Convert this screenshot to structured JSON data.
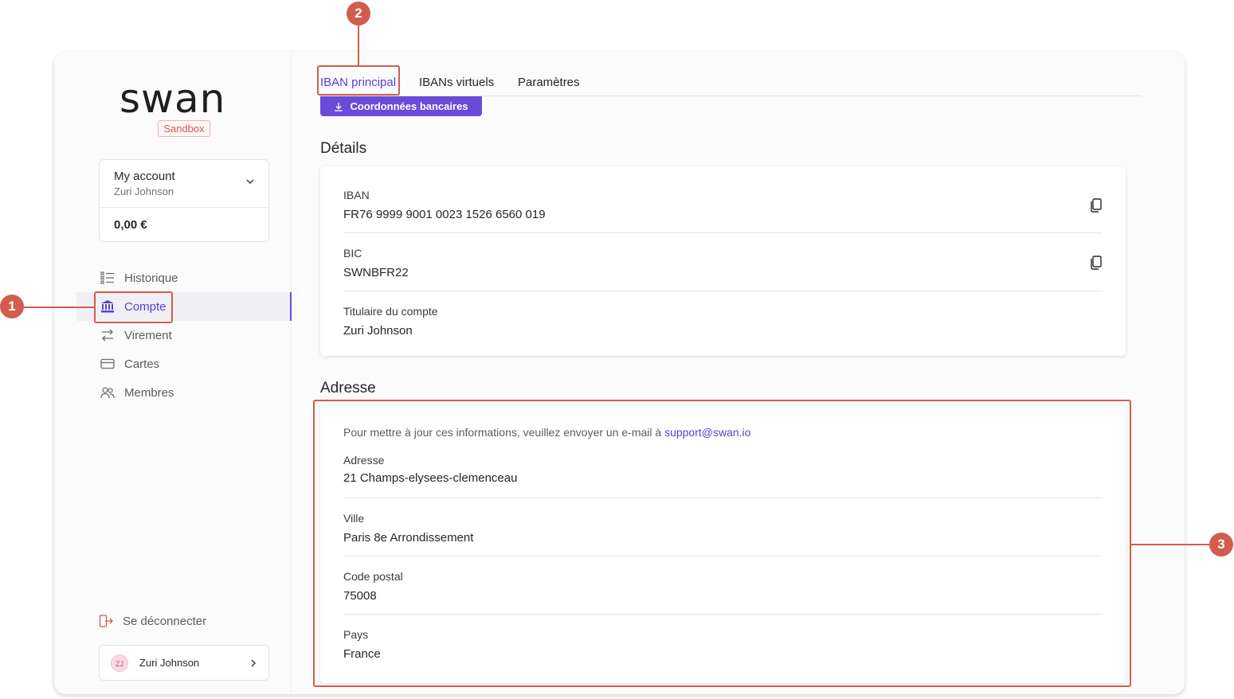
{
  "brand": {
    "logo": "swan",
    "env_badge": "Sandbox"
  },
  "account": {
    "name": "My account",
    "holder": "Zuri Johnson",
    "balance": "0,00 €"
  },
  "nav": {
    "items": [
      {
        "label": "Historique",
        "icon": "list-icon"
      },
      {
        "label": "Compte",
        "icon": "bank-icon"
      },
      {
        "label": "Virement",
        "icon": "transfer-icon"
      },
      {
        "label": "Cartes",
        "icon": "card-icon"
      },
      {
        "label": "Membres",
        "icon": "members-icon"
      }
    ],
    "active": "Compte",
    "logout_label": "Se déconnecter"
  },
  "user": {
    "initials": "ZJ",
    "name": "Zuri Johnson"
  },
  "tabs": [
    {
      "label": "IBAN principal"
    },
    {
      "label": "IBANs virtuels"
    },
    {
      "label": "Paramètres"
    }
  ],
  "active_tab": "IBAN principal",
  "download_button": "Coordonnées bancaires",
  "details": {
    "title": "Détails",
    "fields": [
      {
        "label": "IBAN",
        "value": "FR76 9999 9001 0023 1526 6560 019",
        "copyable": true
      },
      {
        "label": "BIC",
        "value": "SWNBFR22",
        "copyable": true
      },
      {
        "label": "Titulaire du compte",
        "value": "Zuri Johnson",
        "copyable": false
      }
    ]
  },
  "address": {
    "title": "Adresse",
    "note": "Pour mettre à jour ces informations, veuillez envoyer un e-mail à",
    "note_link": "support@swan.io",
    "fields": [
      {
        "label": "Adresse",
        "value": "21 Champs-elysees-clemenceau"
      },
      {
        "label": "Ville",
        "value": "Paris 8e Arrondissement"
      },
      {
        "label": "Code postal",
        "value": "75008"
      },
      {
        "label": "Pays",
        "value": "France"
      }
    ]
  },
  "callouts": [
    "1",
    "2",
    "3"
  ],
  "colors": {
    "accent": "#6a4bd9",
    "annotation": "#d25c4e"
  }
}
